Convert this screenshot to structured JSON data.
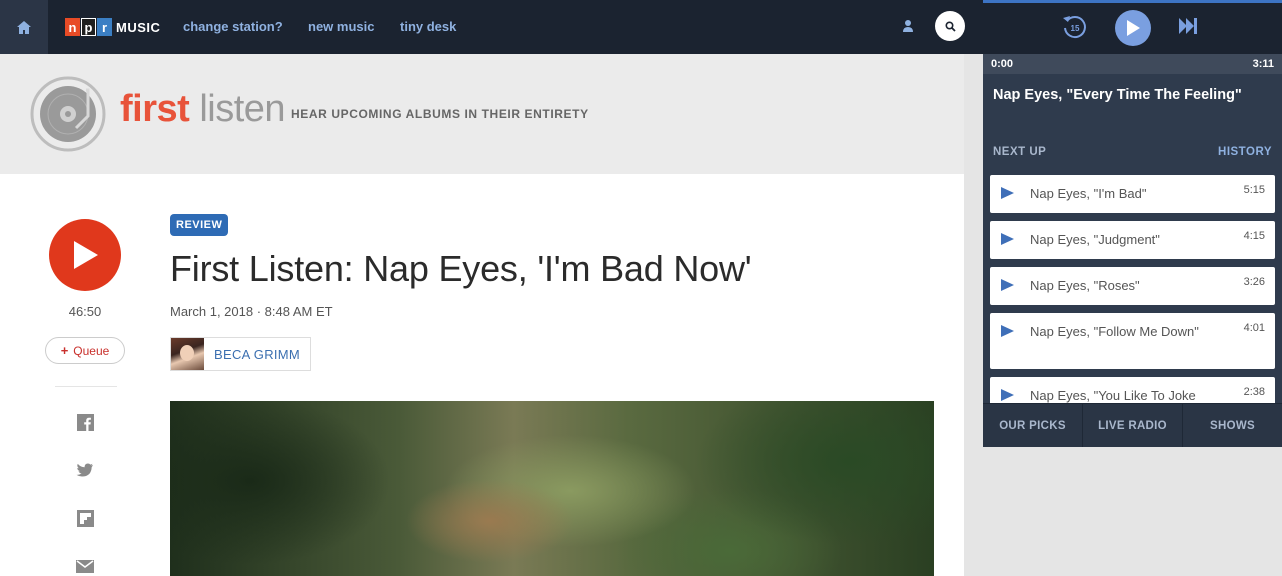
{
  "nav": {
    "logo_letters": [
      "n",
      "p",
      "r"
    ],
    "logo_music": "MUSIC",
    "links": [
      "change station?",
      "new music",
      "tiny desk"
    ]
  },
  "banner": {
    "first": "first",
    "listen": "listen",
    "tagline": "HEAR UPCOMING ALBUMS IN THEIR ENTIRETY"
  },
  "article": {
    "badge": "REVIEW",
    "title": "First Listen: Nap Eyes, 'I'm Bad Now'",
    "dateline": "March 1, 2018 · 8:48 AM ET",
    "author": "BECA GRIMM",
    "duration": "46:50",
    "queue_label": "Queue",
    "queue_plus": "+"
  },
  "player": {
    "time_current": "0:00",
    "time_total": "3:11",
    "now_playing": "Nap Eyes, \"Every Time The Feeling\"",
    "next_up_label": "NEXT UP",
    "history_label": "HISTORY",
    "queue": [
      {
        "title": "Nap Eyes, \"I'm Bad\"",
        "time": "5:15"
      },
      {
        "title": "Nap Eyes, \"Judgment\"",
        "time": "4:15"
      },
      {
        "title": "Nap Eyes, \"Roses\"",
        "time": "3:26"
      },
      {
        "title": "Nap Eyes, \"Follow Me Down\"",
        "time": "4:01"
      },
      {
        "title": "Nap Eyes, \"You Like To Joke",
        "time": "2:38"
      }
    ],
    "tabs": [
      "OUR PICKS",
      "LIVE RADIO",
      "SHOWS"
    ]
  },
  "colors": {
    "accent_blue": "#3d74c4",
    "play_red": "#e0381c",
    "first_listen_red": "#e8533a",
    "nav_bg": "#1b2330"
  }
}
